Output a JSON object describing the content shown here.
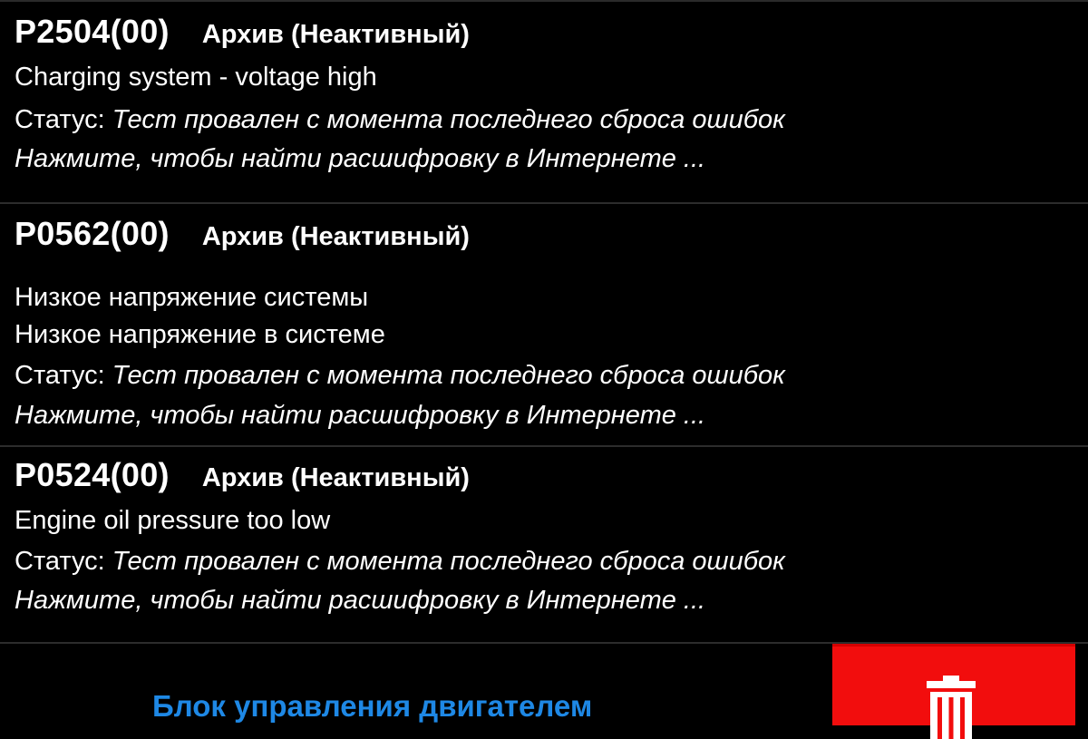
{
  "codes": [
    {
      "code": "P2504(00)",
      "state": "Архив (Неактивный)",
      "descriptions": [
        "Charging system - voltage high"
      ],
      "status_label": "Статус: ",
      "status_value": "Тест провален с момента последнего сброса ошибок",
      "link": "Нажмите, чтобы найти расшифровку в Интернете ..."
    },
    {
      "code": "P0562(00)",
      "state": "Архив (Неактивный)",
      "descriptions": [
        "Низкое напряжение системы",
        "Низкое напряжение в системе"
      ],
      "status_label": "Статус: ",
      "status_value": "Тест провален с момента последнего сброса ошибок",
      "link": "Нажмите, чтобы найти расшифровку в Интернете ..."
    },
    {
      "code": "P0524(00)",
      "state": "Архив (Неактивный)",
      "descriptions": [
        "Engine oil pressure too low"
      ],
      "status_label": "Статус: ",
      "status_value": "Тест провален с момента последнего сброса ошибок",
      "link": "Нажмите, чтобы найти расшифровку в Интернете ..."
    }
  ],
  "bottom_bar": {
    "module_label": "Блок управления двигателем",
    "delete_icon": "trash-icon"
  },
  "colors": {
    "background": "#000000",
    "text": "#ffffff",
    "link_accent": "#1e88e5",
    "delete_button": "#f20d0d"
  }
}
